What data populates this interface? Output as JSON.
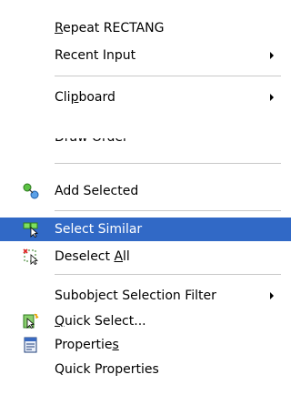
{
  "menu": {
    "items": [
      {
        "key": "repeat",
        "label_pre": "",
        "mnemonic": "R",
        "label_post": "epeat RECTANG"
      },
      {
        "key": "recent_input",
        "label": "Recent Input",
        "submenu": true
      },
      {
        "key": "clipboard",
        "label_pre": "Cli",
        "mnemonic": "p",
        "label_post": "board",
        "submenu": true
      },
      {
        "key": "draw_order",
        "label": "Draw Order",
        "mnemonic_index": 3,
        "partially_visible": true
      },
      {
        "key": "add_selected",
        "label": "Add Selected",
        "icon": "add-selected-icon"
      },
      {
        "key": "select_similar",
        "label": "Select Similar",
        "icon": "select-similar-icon",
        "highlighted": true
      },
      {
        "key": "deselect_all",
        "label_pre": "Deselect ",
        "mnemonic": "A",
        "label_post": "ll",
        "icon": "deselect-all-icon"
      },
      {
        "key": "subobject_filter",
        "label": "Subobject Selection Filter",
        "submenu": true
      },
      {
        "key": "quick_select",
        "label_pre": "",
        "mnemonic": "Q",
        "label_post": "uick Select...",
        "icon": "quick-select-icon"
      },
      {
        "key": "properties",
        "label_pre": "Propertie",
        "mnemonic": "s",
        "label_post": "",
        "icon": "properties-icon"
      },
      {
        "key": "quick_properties",
        "label": "Quick Properties"
      }
    ]
  },
  "colors": {
    "highlight": "#3169c6",
    "separator": "#c8c8c8"
  }
}
